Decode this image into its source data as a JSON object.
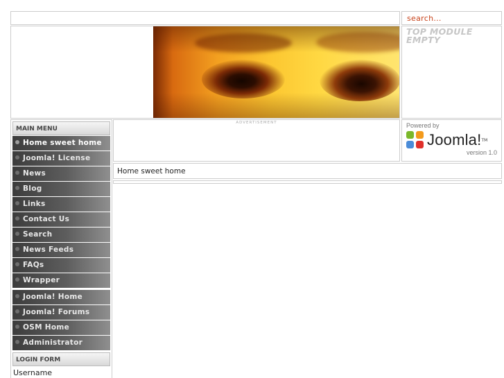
{
  "search": {
    "placeholder": "search..."
  },
  "top_module": {
    "text": "TOP MODULE EMPTY"
  },
  "main_menu": {
    "title": "MAIN MENU",
    "items": [
      {
        "label": "Home sweet home",
        "active": true
      },
      {
        "label": "Joomla! License"
      },
      {
        "label": "News"
      },
      {
        "label": "Blog"
      },
      {
        "label": "Links"
      },
      {
        "label": "Contact Us"
      },
      {
        "label": "Search"
      },
      {
        "label": "News Feeds"
      },
      {
        "label": "FAQs"
      },
      {
        "label": "Wrapper"
      }
    ],
    "extra_items": [
      {
        "label": "Joomla! Home"
      },
      {
        "label": "Joomla! Forums"
      },
      {
        "label": "OSM Home"
      },
      {
        "label": "Administrator"
      }
    ]
  },
  "login_form": {
    "title": "LOGIN FORM",
    "username_label": "Username"
  },
  "advertisement": {
    "label": "ADVERTISEMENT"
  },
  "powered": {
    "powered_by": "Powered by",
    "logo_text": "Joomla!",
    "version": "version 1.0"
  },
  "pathway": {
    "text": "Home sweet home"
  }
}
